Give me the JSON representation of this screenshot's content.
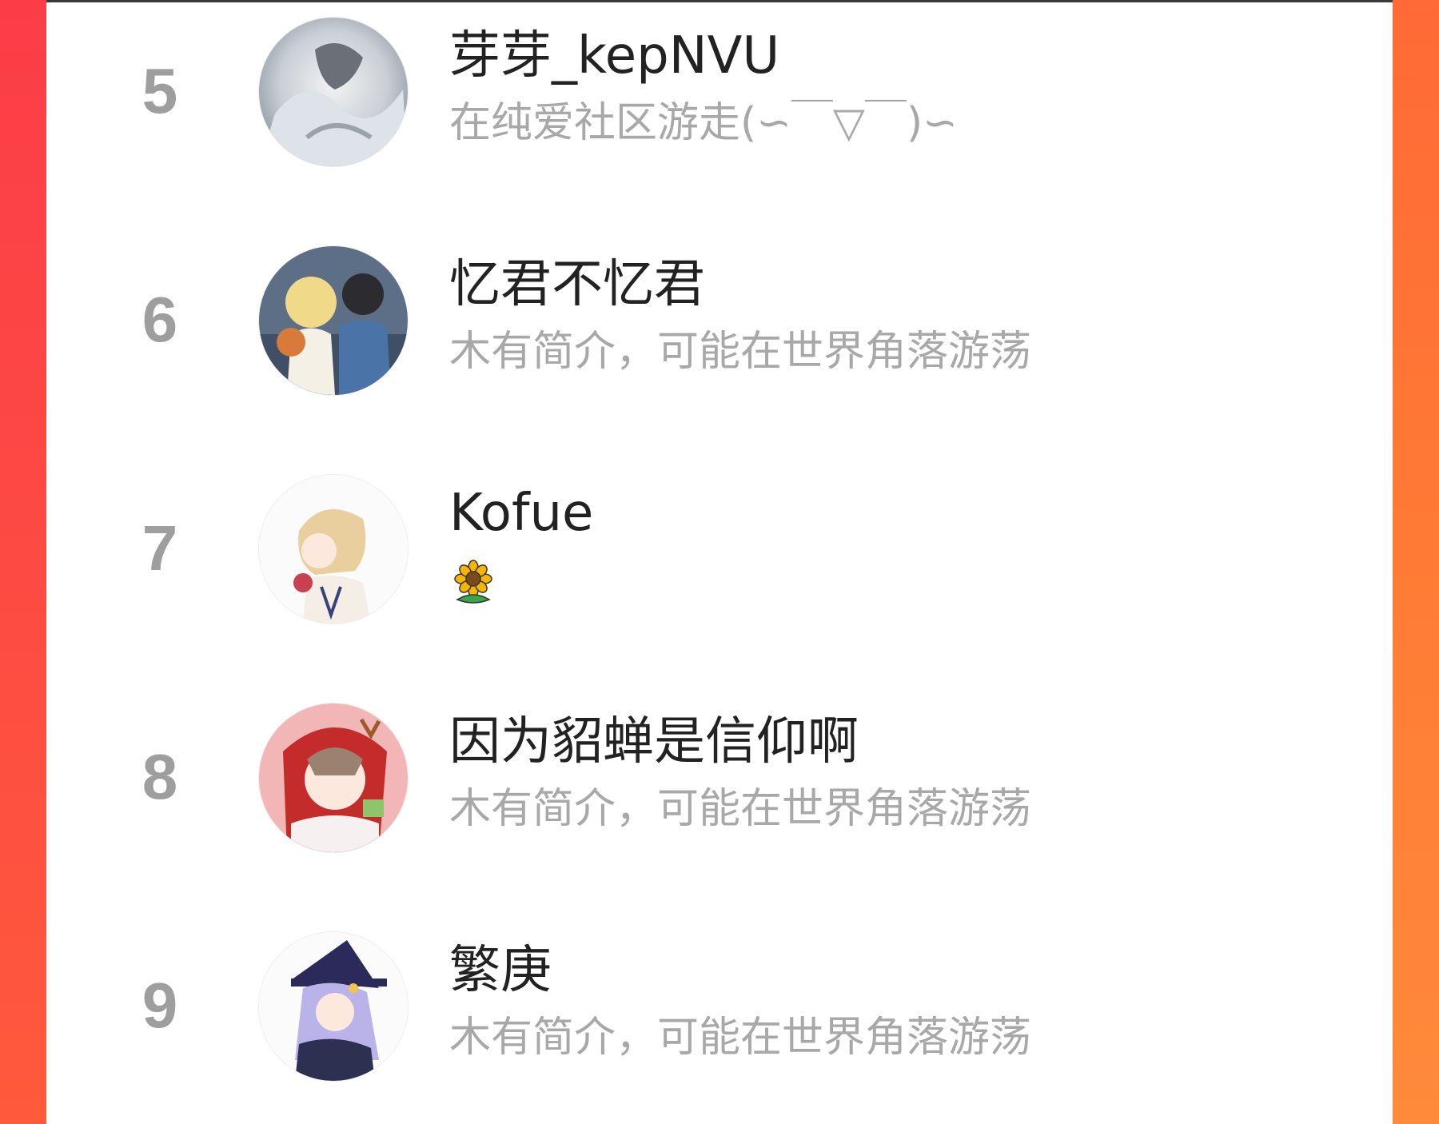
{
  "ranking": {
    "rows": [
      {
        "rank": "5",
        "name": "芽芽_kepNVU",
        "bio": "在纯爱社区游走(∽￣▽￣)∽"
      },
      {
        "rank": "6",
        "name": "忆君不忆君",
        "bio": "木有简介，可能在世界角落游荡"
      },
      {
        "rank": "7",
        "name": "Kofue",
        "bio": "",
        "bio_icon": "sunflower-icon"
      },
      {
        "rank": "8",
        "name": "因为貂蝉是信仰啊",
        "bio": "木有简介，可能在世界角落游荡"
      },
      {
        "rank": "9",
        "name": "繁庚",
        "bio": "木有简介，可能在世界角落游荡"
      }
    ]
  },
  "colors": {
    "frame_left": "#fb3d47",
    "frame_right": "#ff7b35",
    "rank_text": "#9e9e9e",
    "name_text": "#222222",
    "bio_text": "#a8a8a8"
  }
}
